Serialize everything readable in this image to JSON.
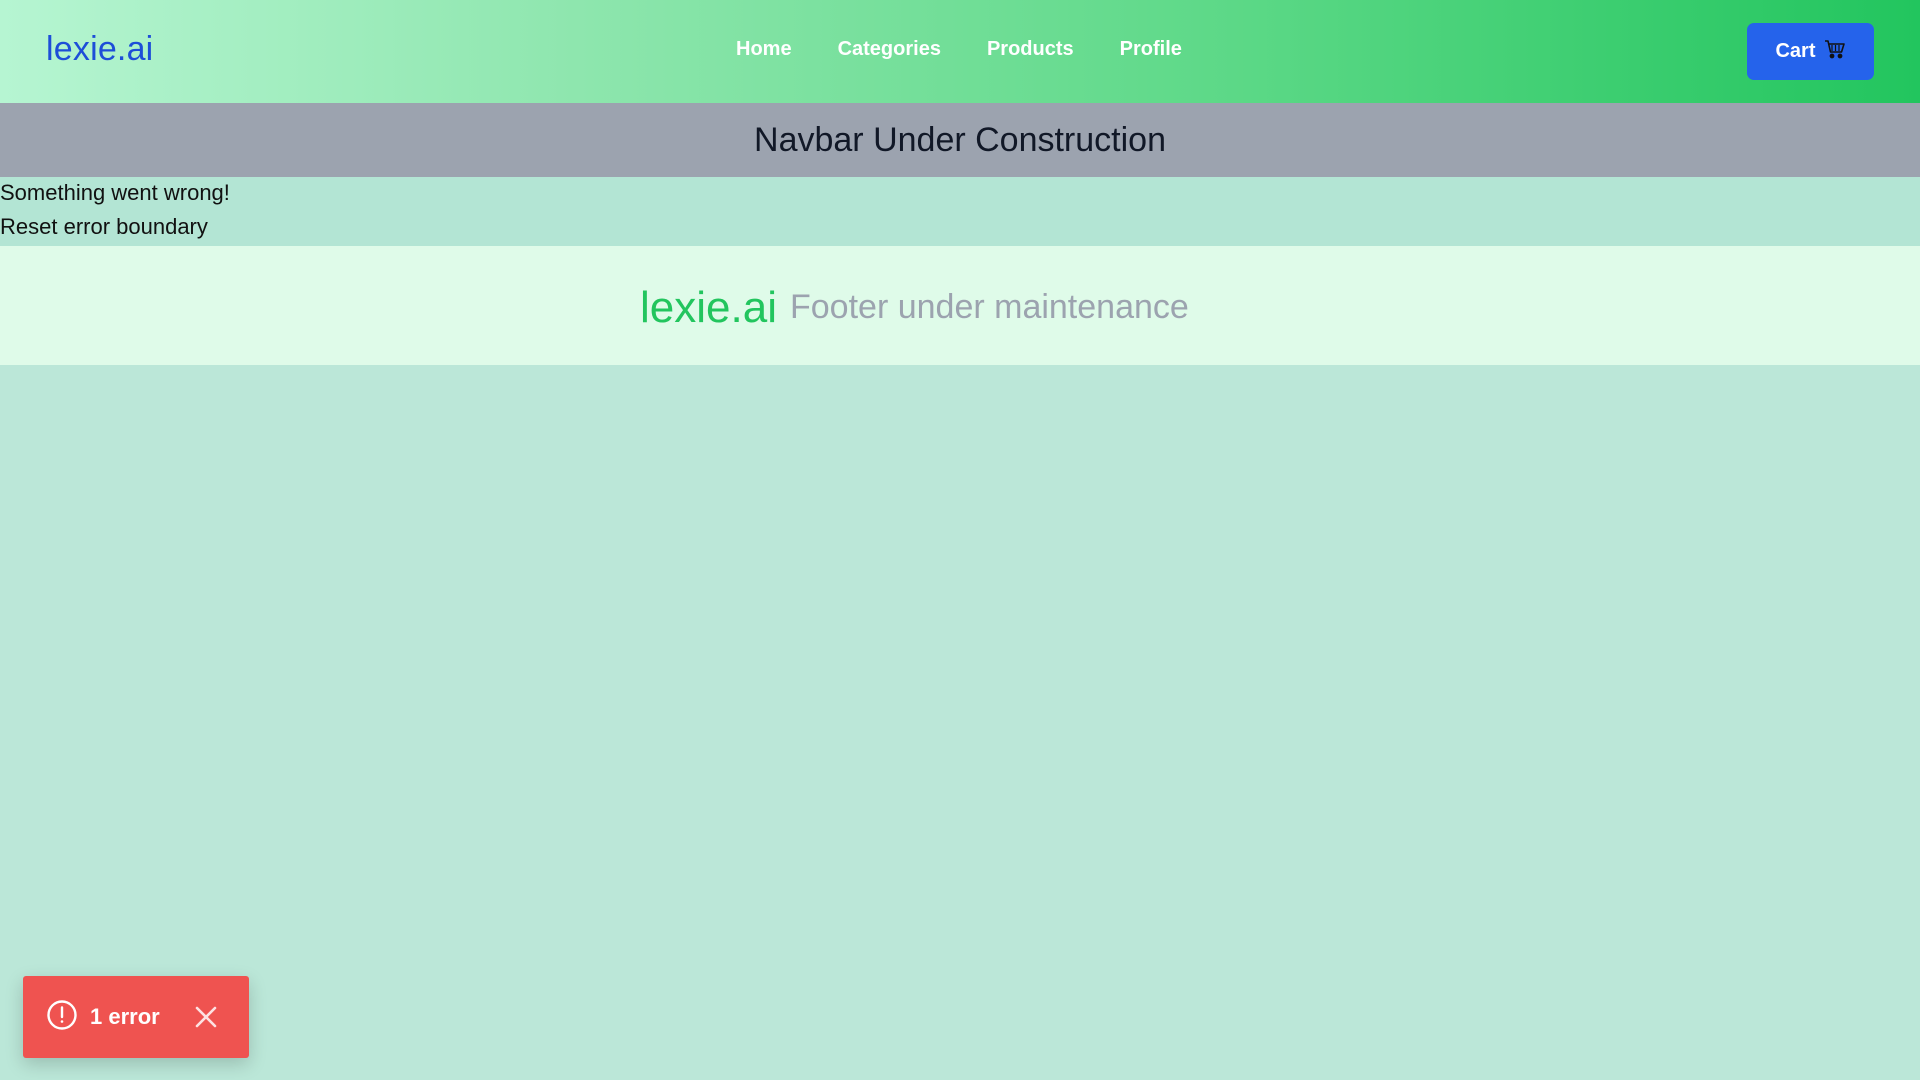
{
  "header": {
    "brand": "lexie.ai",
    "nav": [
      {
        "label": "Home"
      },
      {
        "label": "Categories"
      },
      {
        "label": "Products"
      },
      {
        "label": "Profile"
      }
    ],
    "cart_label": "Cart",
    "cart_icon": "cart-icon",
    "brand_color": "#1d4ed8",
    "gradient": [
      "#b6f5d2",
      "#22c55e"
    ]
  },
  "banner": {
    "text": "Navbar Under Construction"
  },
  "error": {
    "message": "Something went wrong!",
    "reset": "Reset error boundary"
  },
  "footer": {
    "brand": "lexie.ai",
    "text": "Footer under maintenance",
    "brand_color": "#22c55e"
  },
  "toast": {
    "label": "1 error",
    "icon": "alert-circle-icon",
    "close_icon": "close-icon",
    "color": "#ef5350"
  }
}
